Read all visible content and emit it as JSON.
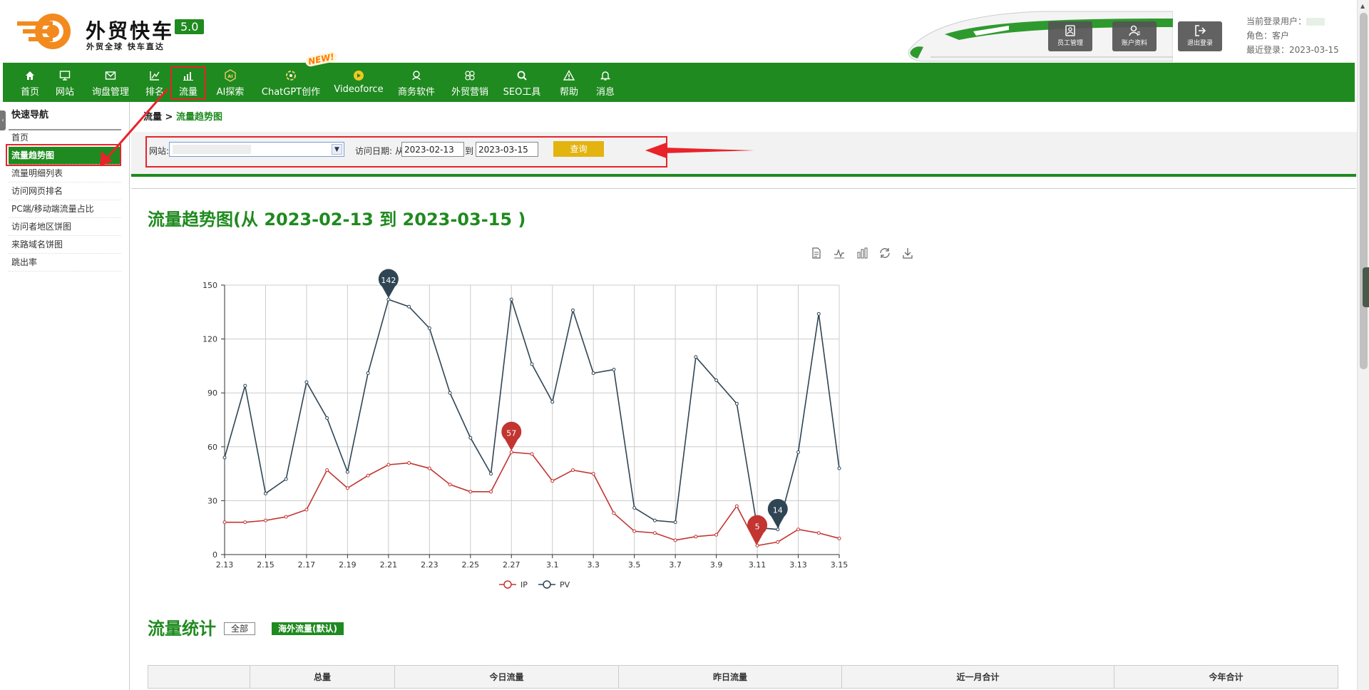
{
  "brand": {
    "name": "外贸快车",
    "version": "5.0",
    "slogan": "外贸全球 快车直达"
  },
  "header_buttons": [
    {
      "label": "员工管理",
      "icon": "staff-icon"
    },
    {
      "label": "账户资料",
      "icon": "account-icon"
    },
    {
      "label": "退出登录",
      "icon": "logout-icon"
    }
  ],
  "user": {
    "current_label": "当前登录用户：",
    "role_label": "角色：",
    "role": "客户",
    "last_login_label": "最近登录：",
    "last_login": "2023-03-15"
  },
  "nav": {
    "items": [
      {
        "label": "首页",
        "icon": "home-icon"
      },
      {
        "label": "网站",
        "icon": "monitor-icon"
      },
      {
        "label": "询盘管理",
        "icon": "mail-icon"
      },
      {
        "label": "排名",
        "icon": "ranking-icon"
      },
      {
        "label": "流量",
        "icon": "bar-chart-icon"
      },
      {
        "label": "AI探索",
        "icon": "ai-icon"
      },
      {
        "label": "ChatGPT创作",
        "icon": "chatgpt-icon"
      },
      {
        "label": "Videoforce",
        "icon": "video-icon"
      },
      {
        "label": "商务软件",
        "icon": "software-icon"
      },
      {
        "label": "外贸营销",
        "icon": "marketing-icon"
      },
      {
        "label": "SEO工具",
        "icon": "search-icon"
      },
      {
        "label": "帮助",
        "icon": "warning-icon"
      },
      {
        "label": "消息",
        "icon": "bell-icon"
      }
    ],
    "new_badge": "NEW!"
  },
  "sidebar": {
    "title": "快速导航",
    "items": [
      {
        "label": "首页"
      },
      {
        "label": "流量趋势图",
        "active": true
      },
      {
        "label": "流量明细列表"
      },
      {
        "label": "访问网页排名"
      },
      {
        "label": "PC端/移动端流量占比"
      },
      {
        "label": "访问者地区饼图"
      },
      {
        "label": "来路域名饼图"
      },
      {
        "label": "跳出率"
      }
    ]
  },
  "breadcrumb": {
    "parent": "流量",
    "sep": " > ",
    "current": "流量趋势图"
  },
  "filter": {
    "site_label": "网站:",
    "date_label": "访问日期: 从",
    "from": "2023-02-13",
    "to_label": "到",
    "to": "2023-03-15",
    "query_label": "查询"
  },
  "chart_title": "流量趋势图(从 2023-02-13 到 2023-03-15 )",
  "toolbox": [
    "data-view-icon",
    "line-icon",
    "bar-icon",
    "restore-icon",
    "download-icon"
  ],
  "chart_data": {
    "type": "line",
    "x": [
      "2.13",
      "2.14",
      "2.15",
      "2.16",
      "2.17",
      "2.18",
      "2.19",
      "2.20",
      "2.21",
      "2.22",
      "2.23",
      "2.24",
      "2.25",
      "2.26",
      "2.27",
      "2.28",
      "3.1",
      "3.2",
      "3.3",
      "3.4",
      "3.5",
      "3.6",
      "3.7",
      "3.8",
      "3.9",
      "3.10",
      "3.11",
      "3.12",
      "3.13",
      "3.14",
      "3.15"
    ],
    "x_tick_labels": [
      "2.13",
      "2.15",
      "2.17",
      "2.19",
      "2.21",
      "2.23",
      "2.25",
      "2.27",
      "3.1",
      "3.3",
      "3.5",
      "3.7",
      "3.9",
      "3.11",
      "3.13",
      "3.15"
    ],
    "y_ticks": [
      "0",
      "30",
      "60",
      "90",
      "120",
      "150"
    ],
    "ylim": [
      0,
      150
    ],
    "grid": true,
    "legend": "bottom-center",
    "series": [
      {
        "name": "IP",
        "color": "#c23531",
        "values": [
          18,
          18,
          19,
          21,
          25,
          47,
          37,
          44,
          50,
          51,
          48,
          39,
          35,
          35,
          57,
          56,
          41,
          47,
          45,
          23,
          13,
          12,
          8,
          10,
          11,
          27,
          5,
          7,
          14,
          12,
          9
        ],
        "markers": [
          {
            "index": 14,
            "label": "57"
          },
          {
            "index": 26,
            "label": "5"
          }
        ]
      },
      {
        "name": "PV",
        "color": "#2f4554",
        "values": [
          54,
          94,
          34,
          42,
          96,
          76,
          46,
          101,
          142,
          138,
          126,
          90,
          65,
          45,
          142,
          106,
          85,
          136,
          101,
          103,
          26,
          19,
          18,
          110,
          97,
          84,
          15,
          14,
          57,
          134,
          48
        ],
        "markers": [
          {
            "index": 8,
            "label": "142"
          },
          {
            "index": 27,
            "label": "14"
          }
        ]
      }
    ]
  },
  "stats": {
    "title": "流量统计",
    "all_label": "全部",
    "overseas_label": "海外流量(默认)",
    "columns": [
      "",
      "总量",
      "今日流量",
      "昨日流量",
      "近一月合计",
      "今年合计"
    ]
  }
}
